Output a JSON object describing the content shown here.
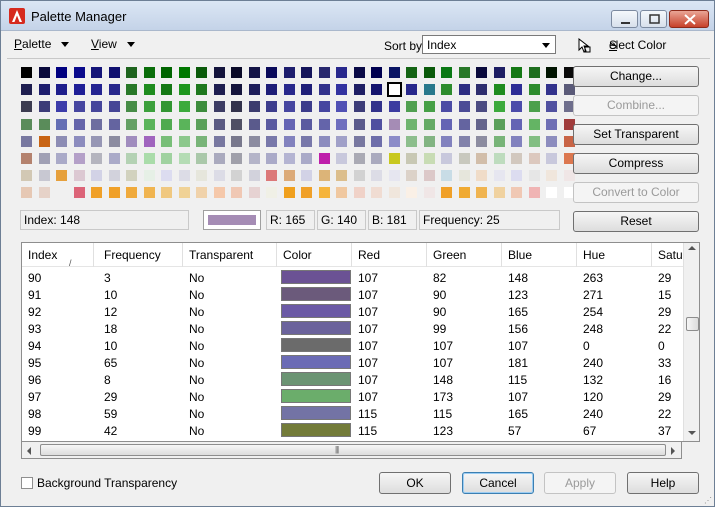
{
  "window": {
    "title": "Palette Manager"
  },
  "menu": {
    "palette_prefix": "P",
    "palette_rest": "alette",
    "view_prefix": "V",
    "view_rest": "iew"
  },
  "sort": {
    "label": "Sort by:",
    "value": "Index"
  },
  "select_color": {
    "label_prefix": "S",
    "label_rest": "elect Color"
  },
  "buttons": {
    "change": "Change...",
    "combine": "Combine...",
    "set_transparent": "Set Transparent",
    "compress": "Compress",
    "convert_to_color": "Convert to Color",
    "reset": "Reset",
    "ok": "OK",
    "cancel": "Cancel",
    "apply": "Apply",
    "help": "Help"
  },
  "info": {
    "index": "Index:  148",
    "r": "R: 165",
    "g": "G: 140",
    "b": "B: 181",
    "frequency": "Frequency: 25",
    "selected_color": "#a58cb5"
  },
  "palette": {
    "selected_row": 1,
    "selected_col": 21,
    "rows": [
      [
        "#000000",
        "#0a0a3c",
        "#000080",
        "#0a0a8c",
        "#141478",
        "#101070",
        "#1e641e",
        "#0a6e0a",
        "#006400",
        "#007800",
        "#0a5a0a",
        "#14143c",
        "#0a0a28",
        "#141446",
        "#0a0a5a",
        "#1e1e6e",
        "#14145a",
        "#28286e",
        "#28288c",
        "#0a0a46",
        "#000050",
        "#0a1464",
        "#146414",
        "#0a5a0a",
        "#0a7814",
        "#287828",
        "#0a0a3c",
        "#1e1e64",
        "#147814",
        "#1e6e1e",
        "#001400",
        "#0a0a0a"
      ],
      [
        "#1e1e50",
        "#1e1e6e",
        "#1e1e8c",
        "#1e1e96",
        "#232391",
        "#28288c",
        "#287828",
        "#1e8c1e",
        "#147814",
        "#1e961e",
        "#1e781e",
        "#1e1e50",
        "#14143c",
        "#1e1e5a",
        "#1e1e78",
        "#28288c",
        "#1e1e78",
        "#32328c",
        "#3232a0",
        "#1e1e64",
        "#14146e",
        "#ffffff",
        "#28288c",
        "#28788c",
        "#2d8c2d",
        "#2d2d82",
        "#2d2d6e",
        "#1e8c1e",
        "#2d2d96",
        "#2d8c2d",
        "#32328c",
        "#5a5a78"
      ],
      [
        "#3c3c50",
        "#3c3c78",
        "#3c3caa",
        "#4646a0",
        "#46469b",
        "#464696",
        "#468c46",
        "#3ca03c",
        "#329632",
        "#3caa3c",
        "#3c8c3c",
        "#3c3c64",
        "#32324b",
        "#3c3c6e",
        "#3c3c8c",
        "#4646a0",
        "#3c3c8c",
        "#4646a0",
        "#5050b4",
        "#3c3c78",
        "#32328c",
        "#3c3ca0",
        "#50a050",
        "#46a046",
        "#4b4ba5",
        "#4b4b96",
        "#4b4b82",
        "#3caa3c",
        "#4b4baa",
        "#4ba04b",
        "#5050a0",
        "#6e6e8c"
      ],
      [
        "#5a8c5a",
        "#5a8c5a",
        "#646eb4",
        "#6464aa",
        "#6e6ea0",
        "#6464a0",
        "#64a064",
        "#5ab45a",
        "#50aa50",
        "#5ab45a",
        "#5aa05a",
        "#5a5a82",
        "#505064",
        "#5a5a8c",
        "#5a5aa0",
        "#6464b4",
        "#5a5aa0",
        "#6464aa",
        "#6e6ebe",
        "#5a5a8c",
        "#5050a0",
        "#a58cb5",
        "#6eb46e",
        "#64aa64",
        "#6464b4",
        "#6464a0",
        "#64648c",
        "#5aa05a",
        "#6464b4",
        "#64b464",
        "#6e6eb4",
        "#a03c3c"
      ],
      [
        "#7878a0",
        "#c86414",
        "#8c8cb4",
        "#8c8cbe",
        "#9696b4",
        "#8c8ca0",
        "#a08cbe",
        "#a064be",
        "#78be78",
        "#8cc88c",
        "#78b478",
        "#7878a0",
        "#78788c",
        "#8c8ca0",
        "#7878aa",
        "#8282be",
        "#7878aa",
        "#8c8cbe",
        "#a0a0c8",
        "#7878a0",
        "#6e6eaa",
        "#8c8cc8",
        "#8cbe8c",
        "#82b482",
        "#8282be",
        "#8282aa",
        "#8c8ca0",
        "#78b478",
        "#8282be",
        "#82be82",
        "#8c8cbe",
        "#c86446"
      ],
      [
        "#b4826e",
        "#a0a0b4",
        "#aaaac8",
        "#b4a0c8",
        "#b4b4be",
        "#aaaac8",
        "#b4d2b4",
        "#aadcaa",
        "#a0d2a0",
        "#b4dcb4",
        "#aac8aa",
        "#aaaabe",
        "#a0a0aa",
        "#b4b4c8",
        "#aaaac8",
        "#b4b4d2",
        "#aaaac8",
        "#be1eaa",
        "#c8c8dc",
        "#aaaab4",
        "#aaaabe",
        "#c8c81e",
        "#c8c8b4",
        "#c8dcb4",
        "#c8c8dc",
        "#c8c8be",
        "#d2beaa",
        "#bedcbe",
        "#d2c8be",
        "#dcc8be",
        "#c8c8dc",
        "#dc7850"
      ],
      [
        "#d2c8b4",
        "#c8c8d2",
        "#e6a03c",
        "#dcc8d2",
        "#d2d2e6",
        "#d2d2dc",
        "#d2d2be",
        "#e6f0e6",
        "#dcdcf0",
        "#dcdce6",
        "#e6e6dc",
        "#dcdce6",
        "#d2d2d2",
        "#d2d2dc",
        "#dc7878",
        "#dcaa78",
        "#d2d2e6",
        "#dcb478",
        "#dcbe8c",
        "#d2d2d2",
        "#dcdce6",
        "#e6e6f0",
        "#dcd2c8",
        "#dcc8c8",
        "#c8dce6",
        "#e6e6dc",
        "#f0dcc8",
        "#e6e6f0",
        "#dcdcf0",
        "#e6e6e6",
        "#f0e6dc",
        "#f0e6e6"
      ],
      [
        "#e6c8b4",
        "#e6d2c8",
        "#f0f0f0",
        "#dc6478",
        "#f0a028",
        "#f0a028",
        "#f0aa3c",
        "#f0b450",
        "#f0c880",
        "#f0d296",
        "#f0d2aa",
        "#f5c8aa",
        "#f0c8b4",
        "#e6d2d2",
        "#f0f0e6",
        "#f0a01e",
        "#f0a028",
        "#f5b43c",
        "#f0c8a0",
        "#f0d2c8",
        "#f0dcd2",
        "#f0e6dc",
        "#faf0e6",
        "#f0e6e6",
        "#f0a028",
        "#f0aa32",
        "#f0b450",
        "#f0d2a0",
        "#f0c8b4",
        "#f0b4b4",
        "#ffffff",
        "#ffffff"
      ]
    ]
  },
  "list": {
    "columns": [
      "Index",
      "Frequency",
      "Transparent",
      "Color",
      "Red",
      "Green",
      "Blue",
      "Hue",
      "Satu"
    ],
    "rows": [
      {
        "index": "90",
        "frequency": "3",
        "transparent": "No",
        "color": "#6b5294",
        "red": "107",
        "green": "82",
        "blue": "148",
        "hue": "263",
        "sat": "29"
      },
      {
        "index": "91",
        "frequency": "10",
        "transparent": "No",
        "color": "#6b5a7b",
        "red": "107",
        "green": "90",
        "blue": "123",
        "hue": "271",
        "sat": "15"
      },
      {
        "index": "92",
        "frequency": "12",
        "transparent": "No",
        "color": "#6b5aa5",
        "red": "107",
        "green": "90",
        "blue": "165",
        "hue": "254",
        "sat": "29"
      },
      {
        "index": "93",
        "frequency": "18",
        "transparent": "No",
        "color": "#6b639c",
        "red": "107",
        "green": "99",
        "blue": "156",
        "hue": "248",
        "sat": "22"
      },
      {
        "index": "94",
        "frequency": "10",
        "transparent": "No",
        "color": "#6b6b6b",
        "red": "107",
        "green": "107",
        "blue": "107",
        "hue": "0",
        "sat": "0"
      },
      {
        "index": "95",
        "frequency": "65",
        "transparent": "No",
        "color": "#6b6bb5",
        "red": "107",
        "green": "107",
        "blue": "181",
        "hue": "240",
        "sat": "33"
      },
      {
        "index": "96",
        "frequency": "8",
        "transparent": "No",
        "color": "#6b9473",
        "red": "107",
        "green": "148",
        "blue": "115",
        "hue": "132",
        "sat": "16"
      },
      {
        "index": "97",
        "frequency": "29",
        "transparent": "No",
        "color": "#6bad6b",
        "red": "107",
        "green": "173",
        "blue": "107",
        "hue": "120",
        "sat": "29"
      },
      {
        "index": "98",
        "frequency": "59",
        "transparent": "No",
        "color": "#7373a5",
        "red": "115",
        "green": "115",
        "blue": "165",
        "hue": "240",
        "sat": "22"
      },
      {
        "index": "99",
        "frequency": "42",
        "transparent": "No",
        "color": "#737b39",
        "red": "115",
        "green": "123",
        "blue": "57",
        "hue": "67",
        "sat": "37"
      }
    ]
  },
  "footer": {
    "background_transparency": "Background Transparency"
  }
}
